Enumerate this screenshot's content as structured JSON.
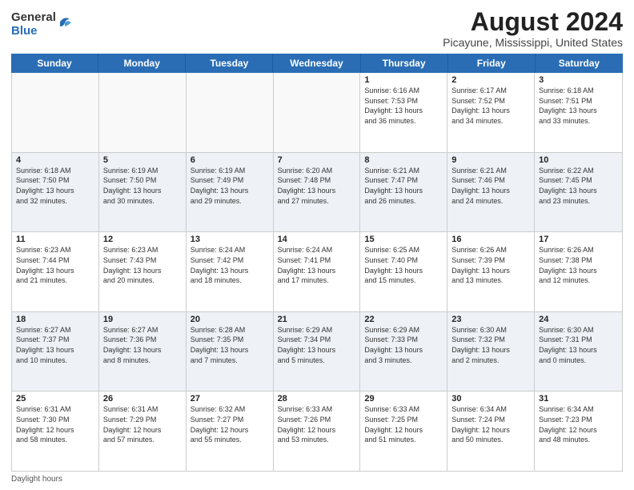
{
  "logo": {
    "general": "General",
    "blue": "Blue"
  },
  "header": {
    "title": "August 2024",
    "subtitle": "Picayune, Mississippi, United States"
  },
  "weekdays": [
    "Sunday",
    "Monday",
    "Tuesday",
    "Wednesday",
    "Thursday",
    "Friday",
    "Saturday"
  ],
  "footer_label": "Daylight hours",
  "rows": [
    [
      {
        "day": "",
        "info": ""
      },
      {
        "day": "",
        "info": ""
      },
      {
        "day": "",
        "info": ""
      },
      {
        "day": "",
        "info": ""
      },
      {
        "day": "1",
        "info": "Sunrise: 6:16 AM\nSunset: 7:53 PM\nDaylight: 13 hours\nand 36 minutes."
      },
      {
        "day": "2",
        "info": "Sunrise: 6:17 AM\nSunset: 7:52 PM\nDaylight: 13 hours\nand 34 minutes."
      },
      {
        "day": "3",
        "info": "Sunrise: 6:18 AM\nSunset: 7:51 PM\nDaylight: 13 hours\nand 33 minutes."
      }
    ],
    [
      {
        "day": "4",
        "info": "Sunrise: 6:18 AM\nSunset: 7:50 PM\nDaylight: 13 hours\nand 32 minutes."
      },
      {
        "day": "5",
        "info": "Sunrise: 6:19 AM\nSunset: 7:50 PM\nDaylight: 13 hours\nand 30 minutes."
      },
      {
        "day": "6",
        "info": "Sunrise: 6:19 AM\nSunset: 7:49 PM\nDaylight: 13 hours\nand 29 minutes."
      },
      {
        "day": "7",
        "info": "Sunrise: 6:20 AM\nSunset: 7:48 PM\nDaylight: 13 hours\nand 27 minutes."
      },
      {
        "day": "8",
        "info": "Sunrise: 6:21 AM\nSunset: 7:47 PM\nDaylight: 13 hours\nand 26 minutes."
      },
      {
        "day": "9",
        "info": "Sunrise: 6:21 AM\nSunset: 7:46 PM\nDaylight: 13 hours\nand 24 minutes."
      },
      {
        "day": "10",
        "info": "Sunrise: 6:22 AM\nSunset: 7:45 PM\nDaylight: 13 hours\nand 23 minutes."
      }
    ],
    [
      {
        "day": "11",
        "info": "Sunrise: 6:23 AM\nSunset: 7:44 PM\nDaylight: 13 hours\nand 21 minutes."
      },
      {
        "day": "12",
        "info": "Sunrise: 6:23 AM\nSunset: 7:43 PM\nDaylight: 13 hours\nand 20 minutes."
      },
      {
        "day": "13",
        "info": "Sunrise: 6:24 AM\nSunset: 7:42 PM\nDaylight: 13 hours\nand 18 minutes."
      },
      {
        "day": "14",
        "info": "Sunrise: 6:24 AM\nSunset: 7:41 PM\nDaylight: 13 hours\nand 17 minutes."
      },
      {
        "day": "15",
        "info": "Sunrise: 6:25 AM\nSunset: 7:40 PM\nDaylight: 13 hours\nand 15 minutes."
      },
      {
        "day": "16",
        "info": "Sunrise: 6:26 AM\nSunset: 7:39 PM\nDaylight: 13 hours\nand 13 minutes."
      },
      {
        "day": "17",
        "info": "Sunrise: 6:26 AM\nSunset: 7:38 PM\nDaylight: 13 hours\nand 12 minutes."
      }
    ],
    [
      {
        "day": "18",
        "info": "Sunrise: 6:27 AM\nSunset: 7:37 PM\nDaylight: 13 hours\nand 10 minutes."
      },
      {
        "day": "19",
        "info": "Sunrise: 6:27 AM\nSunset: 7:36 PM\nDaylight: 13 hours\nand 8 minutes."
      },
      {
        "day": "20",
        "info": "Sunrise: 6:28 AM\nSunset: 7:35 PM\nDaylight: 13 hours\nand 7 minutes."
      },
      {
        "day": "21",
        "info": "Sunrise: 6:29 AM\nSunset: 7:34 PM\nDaylight: 13 hours\nand 5 minutes."
      },
      {
        "day": "22",
        "info": "Sunrise: 6:29 AM\nSunset: 7:33 PM\nDaylight: 13 hours\nand 3 minutes."
      },
      {
        "day": "23",
        "info": "Sunrise: 6:30 AM\nSunset: 7:32 PM\nDaylight: 13 hours\nand 2 minutes."
      },
      {
        "day": "24",
        "info": "Sunrise: 6:30 AM\nSunset: 7:31 PM\nDaylight: 13 hours\nand 0 minutes."
      }
    ],
    [
      {
        "day": "25",
        "info": "Sunrise: 6:31 AM\nSunset: 7:30 PM\nDaylight: 12 hours\nand 58 minutes."
      },
      {
        "day": "26",
        "info": "Sunrise: 6:31 AM\nSunset: 7:29 PM\nDaylight: 12 hours\nand 57 minutes."
      },
      {
        "day": "27",
        "info": "Sunrise: 6:32 AM\nSunset: 7:27 PM\nDaylight: 12 hours\nand 55 minutes."
      },
      {
        "day": "28",
        "info": "Sunrise: 6:33 AM\nSunset: 7:26 PM\nDaylight: 12 hours\nand 53 minutes."
      },
      {
        "day": "29",
        "info": "Sunrise: 6:33 AM\nSunset: 7:25 PM\nDaylight: 12 hours\nand 51 minutes."
      },
      {
        "day": "30",
        "info": "Sunrise: 6:34 AM\nSunset: 7:24 PM\nDaylight: 12 hours\nand 50 minutes."
      },
      {
        "day": "31",
        "info": "Sunrise: 6:34 AM\nSunset: 7:23 PM\nDaylight: 12 hours\nand 48 minutes."
      }
    ]
  ]
}
